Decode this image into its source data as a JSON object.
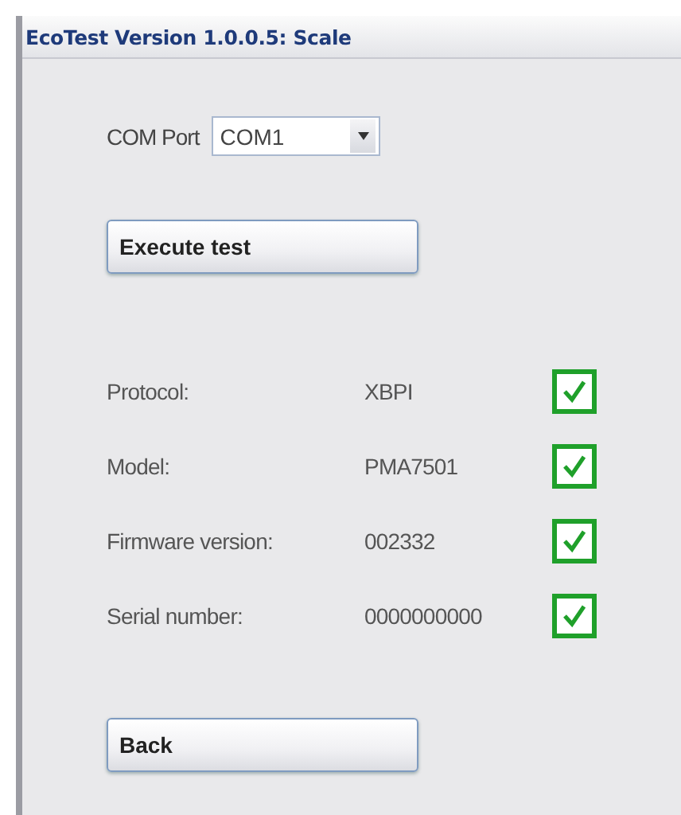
{
  "window": {
    "title": "EcoTest Version 1.0.0.5: Scale"
  },
  "com_port": {
    "label": "COM Port",
    "value": "COM1"
  },
  "execute_button": "Execute test",
  "results": [
    {
      "label": "Protocol:",
      "value": "XBPI",
      "checked": true
    },
    {
      "label": "Model:",
      "value": "PMA7501",
      "checked": true
    },
    {
      "label": "Firmware version:",
      "value": "002332",
      "checked": true
    },
    {
      "label": "Serial number:",
      "value": "0000000000",
      "checked": true
    }
  ],
  "back_button": "Back"
}
